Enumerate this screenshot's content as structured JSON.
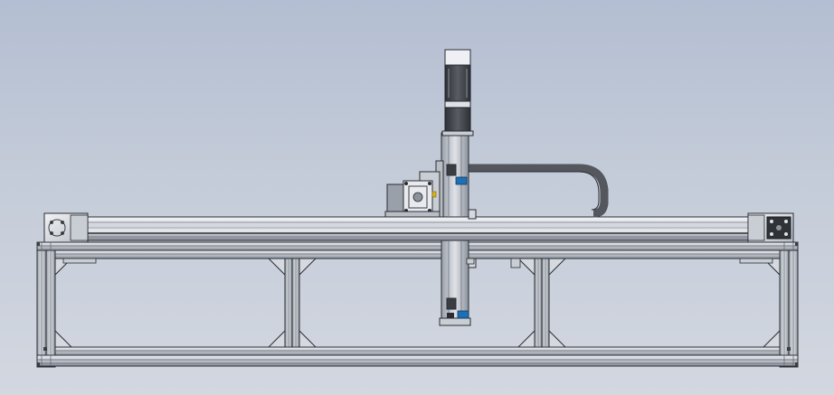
{
  "scene": {
    "view": "front",
    "subject": "gantry-robot-assembly",
    "background_gradient": [
      "#b4bed2",
      "#c4ccd9",
      "#d3d7e0"
    ],
    "colors": {
      "profile_light": "#dde1e7",
      "profile_mid": "#aab1bc",
      "profile_dark": "#6e7480",
      "edge_line": "#2a2d33",
      "motor_dark": "#3c3f44",
      "motor_face": "#e8eaee",
      "cable_chain": "#54575d",
      "sensor_blue": "#1f6fb4",
      "accent_yellow": "#d8b418"
    },
    "icons": {
      "vertical_motor": "stepper-motor-icon",
      "horizontal_motor": "stepper-motor-icon",
      "sensors": "limit-sensor-icon",
      "end_plates": "bolt-plate-icon"
    }
  }
}
